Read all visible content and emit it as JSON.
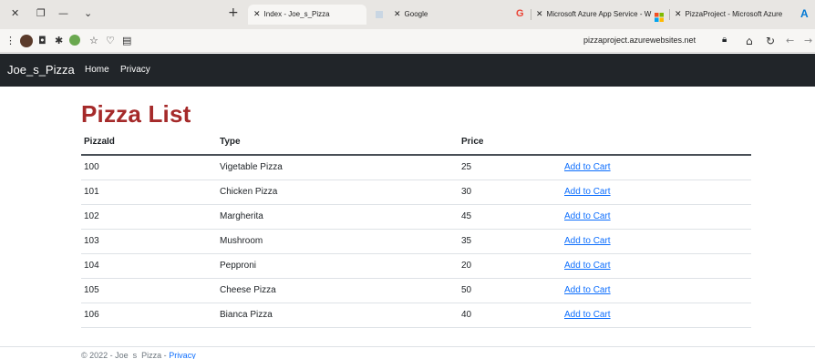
{
  "browser": {
    "tabs": [
      {
        "title": "Index - Joe_s_Pizza",
        "active": true
      },
      {
        "title": "Google",
        "active": false
      },
      {
        "title": "Microsoft Azure App Service - W",
        "active": false
      },
      {
        "title": "PizzaProject - Microsoft Azure",
        "active": false
      }
    ],
    "url": "pizzaproject.azurewebsites.net"
  },
  "navbar": {
    "brand": "Joe_s_Pizza",
    "links": [
      "Home",
      "Privacy"
    ]
  },
  "main": {
    "title": "Pizza List",
    "table": {
      "headers": [
        "PizzaId",
        "Type",
        "Price",
        ""
      ],
      "rows": [
        {
          "id": "100",
          "type": "Vigetable Pizza",
          "price": "25",
          "action": "Add to Cart"
        },
        {
          "id": "101",
          "type": "Chicken Pizza",
          "price": "30",
          "action": "Add to Cart"
        },
        {
          "id": "102",
          "type": "Margherita",
          "price": "45",
          "action": "Add to Cart"
        },
        {
          "id": "103",
          "type": "Mushroom",
          "price": "35",
          "action": "Add to Cart"
        },
        {
          "id": "104",
          "type": "Pepproni",
          "price": "20",
          "action": "Add to Cart"
        },
        {
          "id": "105",
          "type": "Cheese Pizza",
          "price": "50",
          "action": "Add to Cart"
        },
        {
          "id": "106",
          "type": "Bianca Pizza",
          "price": "40",
          "action": "Add to Cart"
        }
      ]
    }
  },
  "footer": {
    "text": "© 2022 - Joe_s_Pizza - ",
    "link": "Privacy"
  },
  "colors": {
    "title": "#a52a2a",
    "navbar": "#212529",
    "link": "#0d6efd"
  }
}
